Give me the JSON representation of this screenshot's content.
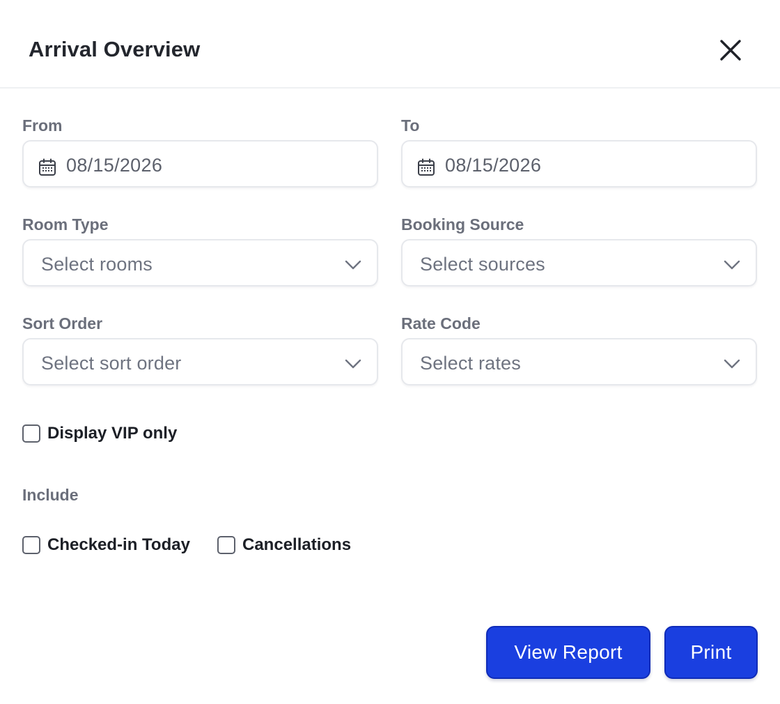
{
  "title": "Arrival Overview",
  "colors": {
    "primary": "#1a3fe0",
    "border": "#e6e8ec",
    "label": "#6b6f7b"
  },
  "icons": {
    "close": "close-icon",
    "calendar": "calendar-icon",
    "dropdown": "chevron-down-icon"
  },
  "from": {
    "label": "From",
    "value": "08/15/2026"
  },
  "to": {
    "label": "To",
    "value": "08/15/2026"
  },
  "room_type": {
    "label": "Room Type",
    "placeholder": "Select rooms"
  },
  "booking_source": {
    "label": "Booking Source",
    "placeholder": "Select sources"
  },
  "sort_order": {
    "label": "Sort Order",
    "placeholder": "Select sort order"
  },
  "rate_code": {
    "label": "Rate Code",
    "placeholder": "Select rates"
  },
  "vip_only": {
    "label": "Display VIP only",
    "checked": false
  },
  "include": {
    "label": "Include",
    "options": [
      {
        "label": "Checked-in Today",
        "checked": false
      },
      {
        "label": "Cancellations",
        "checked": false
      }
    ]
  },
  "actions": {
    "view_report": "View Report",
    "print": "Print"
  }
}
